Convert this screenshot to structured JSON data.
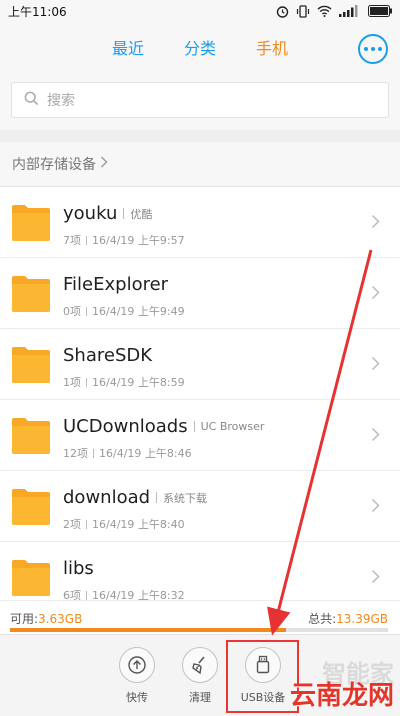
{
  "status": {
    "time": "上午11:06"
  },
  "nav": {
    "tabs": [
      "最近",
      "分类",
      "手机"
    ],
    "active_tab": "手机",
    "accent": "#1a9ee8",
    "active_color": "#f08a1c"
  },
  "search": {
    "placeholder": "搜索"
  },
  "breadcrumb": {
    "label": "内部存储设备"
  },
  "files": [
    {
      "name": "youku",
      "tag": "优酷",
      "count": "7项",
      "date": "16/4/19 上午9:57"
    },
    {
      "name": "FileExplorer",
      "tag": "",
      "count": "0项",
      "date": "16/4/19 上午9:49"
    },
    {
      "name": "ShareSDK",
      "tag": "",
      "count": "1项",
      "date": "16/4/19 上午8:59"
    },
    {
      "name": "UCDownloads",
      "tag": "UC Browser",
      "count": "12项",
      "date": "16/4/19 上午8:46"
    },
    {
      "name": "download",
      "tag": "系统下载",
      "count": "2项",
      "date": "16/4/19 上午8:40"
    },
    {
      "name": "libs",
      "tag": "",
      "count": "6项",
      "date": "16/4/19 上午8:32"
    }
  ],
  "storage": {
    "available_label": "可用:",
    "available": "3.63GB",
    "total_label": "总共:",
    "total": "13.39GB",
    "used_fraction": 0.73
  },
  "bottom": [
    {
      "label": "快传",
      "icon": "upload-circle-icon"
    },
    {
      "label": "清理",
      "icon": "broom-icon"
    },
    {
      "label": "USB设备",
      "icon": "usb-icon"
    }
  ],
  "watermark": {
    "faint": "智能家",
    "main": "云南龙网"
  }
}
